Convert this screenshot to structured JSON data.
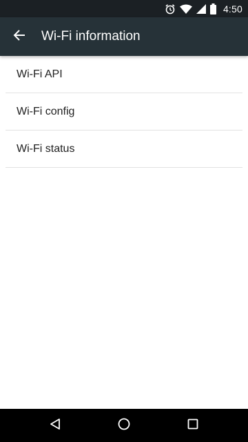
{
  "status_bar": {
    "time": "4:50",
    "icons": [
      "alarm-icon",
      "wifi-icon",
      "cell-signal-icon",
      "battery-icon"
    ]
  },
  "app_bar": {
    "title": "Wi-Fi information",
    "back_icon": "arrow-back-icon",
    "background": "#263238"
  },
  "list": {
    "items": [
      {
        "label": "Wi-Fi API"
      },
      {
        "label": "Wi-Fi config"
      },
      {
        "label": "Wi-Fi status"
      }
    ]
  },
  "nav_bar": {
    "buttons": [
      "back-triangle-icon",
      "home-circle-icon",
      "recents-square-icon"
    ]
  }
}
